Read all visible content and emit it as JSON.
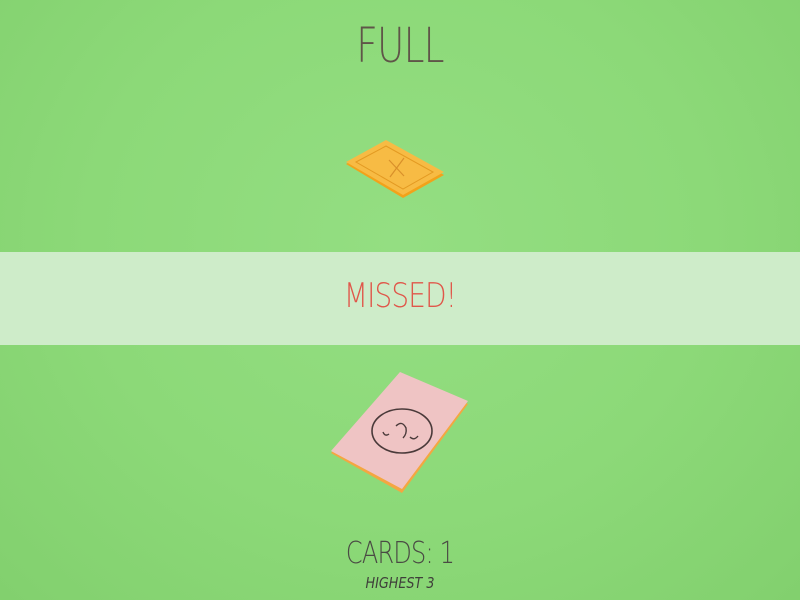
{
  "header": {
    "mode_label": "FULL"
  },
  "top_card": {
    "symbol": "x-mark-icon",
    "color": "#f5b83c",
    "border_color": "#f2a21a"
  },
  "banner": {
    "message": "MISSED!",
    "text_color": "#e0574a",
    "background_color": "#ceecc9"
  },
  "bottom_card": {
    "symbol": "sad-face-icon",
    "color": "#efc4c4",
    "edge_color": "#f4a641"
  },
  "footer": {
    "cards_label": "CARDS: 1",
    "highest_label": "HIGHEST 3"
  },
  "colors": {
    "background": "#8cd978",
    "title_text": "#5f5548"
  }
}
